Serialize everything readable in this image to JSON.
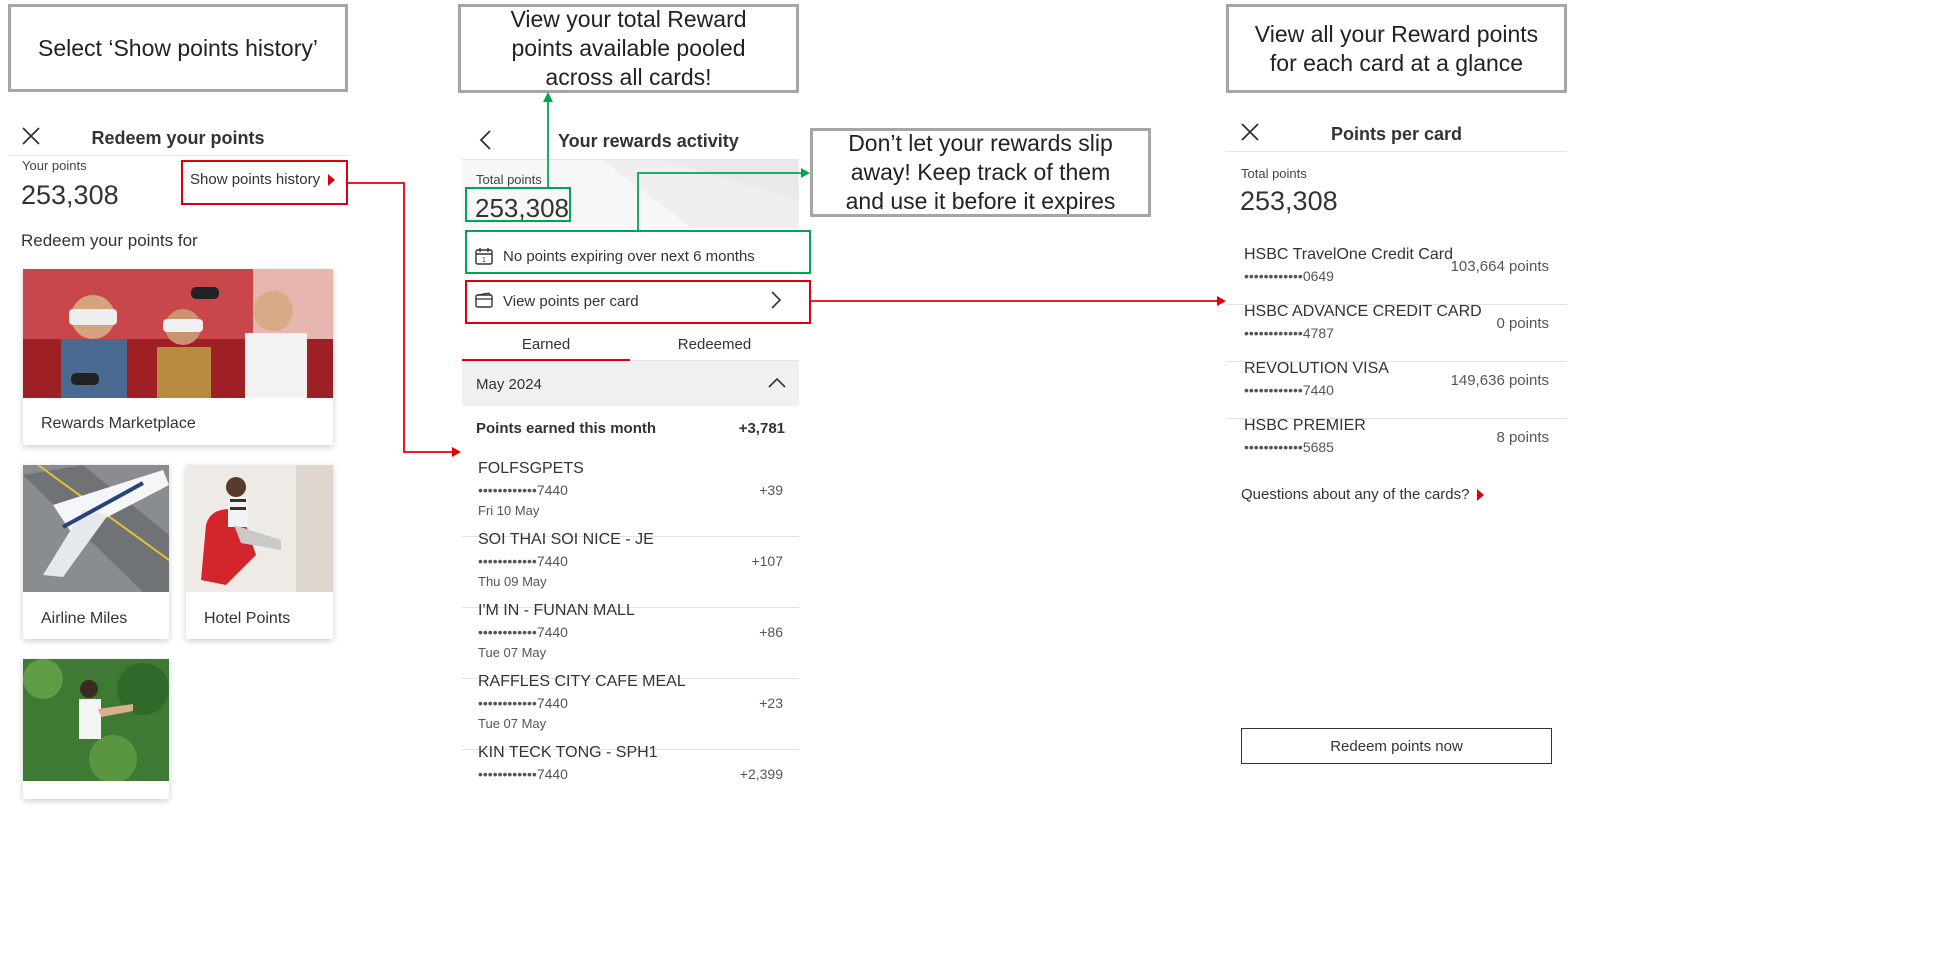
{
  "callouts": {
    "show_history": "Select ‘Show points history’",
    "total_points": "View your total Reward points available pooled across all cards!",
    "expiring": "Don’t let your rewards slip away! Keep track of them and use it before it expires",
    "per_card": "View all your Reward points for each card at a glance"
  },
  "redeem_screen": {
    "title": "Redeem your points",
    "points_label": "Your points",
    "points_value": "253,308",
    "show_history_link": "Show points history",
    "section_title": "Redeem your points for",
    "tiles": [
      {
        "label": "Rewards Marketplace"
      },
      {
        "label": "Airline Miles"
      },
      {
        "label": "Hotel Points"
      }
    ]
  },
  "activity_screen": {
    "title": "Your rewards activity",
    "total_label": "Total points",
    "total_value": "253,308",
    "expiring_text": "No points expiring over next 6 months",
    "per_card_link": "View points per card",
    "tabs": [
      "Earned",
      "Redeemed"
    ],
    "month": "May 2024",
    "summary_label": "Points earned this month",
    "summary_value": "+3,781",
    "transactions": [
      {
        "merchant": "FOLFSGPETS",
        "card": "••••••••••••7440",
        "date": "Fri 10 May",
        "points": "+39"
      },
      {
        "merchant": "SOI THAI SOI NICE - JE",
        "card": "••••••••••••7440",
        "date": "Thu 09 May",
        "points": "+107"
      },
      {
        "merchant": "I'M IN - FUNAN MALL",
        "card": "••••••••••••7440",
        "date": "Tue 07 May",
        "points": "+86"
      },
      {
        "merchant": "RAFFLES CITY CAFE MEAL",
        "card": "••••••••••••7440",
        "date": "Tue 07 May",
        "points": "+23"
      },
      {
        "merchant": "KIN TECK TONG  - SPH1",
        "card": "••••••••••••7440",
        "date": "",
        "points": "+2,399"
      }
    ]
  },
  "per_card_screen": {
    "title": "Points per card",
    "total_label": "Total points",
    "total_value": "253,308",
    "cards": [
      {
        "name": "HSBC TravelOne Credit Card",
        "number": "••••••••••••0649",
        "points": "103,664 points"
      },
      {
        "name": "HSBC ADVANCE CREDIT CARD",
        "number": "••••••••••••4787",
        "points": "0 points"
      },
      {
        "name": "REVOLUTION VISA",
        "number": "••••••••••••7440",
        "points": "149,636 points"
      },
      {
        "name": "HSBC PREMIER",
        "number": "••••••••••••5685",
        "points": "8 points"
      }
    ],
    "questions_link": "Questions about any of the cards?",
    "redeem_button": "Redeem points now"
  },
  "colors": {
    "hsbc_red": "#db0011",
    "green_highlight": "#00a651",
    "callout_border": "#a6a6a6"
  },
  "icons": [
    "close-icon",
    "back-arrow-icon",
    "calendar-icon",
    "card-wallet-icon",
    "chevron-right-icon",
    "chevron-up-icon",
    "red-triangle-icon"
  ]
}
